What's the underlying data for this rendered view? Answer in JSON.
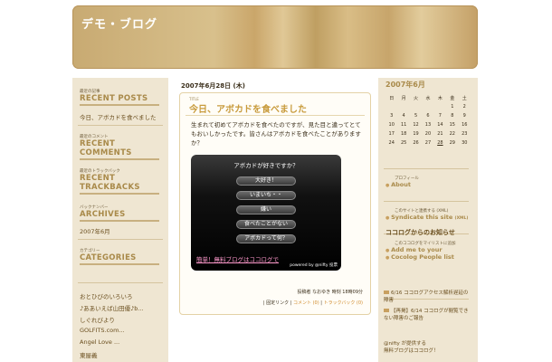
{
  "header": {
    "title": "デモ・ブログ"
  },
  "left": {
    "recent_posts_small": "最近の記事",
    "recent_posts": "RECENT POSTS",
    "recent_post_1": "今日、アボカドを食べました",
    "recent_comments_small": "最近のコメント",
    "recent_comments": "RECENT COMMENTS",
    "recent_trackbacks_small": "最近のトラックバック",
    "recent_trackbacks": "RECENT TRACKBACKS",
    "archives_small": "バックナンバー",
    "archives": "ARCHIVES",
    "archive_1": "2007年6月",
    "categories_small": "カテゴリー",
    "categories": "CATEGORIES",
    "links": [
      "おとひびのいろいろ",
      "♪ああいえば山田優♪b...",
      "しぐれびより",
      "GOLFITS.com...",
      "Angel Love ...",
      "東屋義"
    ]
  },
  "main": {
    "date": "2007年6月28日 (木)",
    "post_tag": "TITLE",
    "post_title": "今日、アボカドを食べました",
    "body": "生まれて初めてアボカドを食べたのですが、見た目と違ってとてもおいしかったです。皆さんはアボカドを食べたことがありますか？",
    "poll": {
      "question": "アボカドが好きですか？",
      "options": [
        "大好き！",
        "いまいち・・",
        "嫌い",
        "食べたことがない",
        "アボカドって何？"
      ],
      "link": "簡単！無料ブログはココログで",
      "powered": "powered by @nifty 投票"
    },
    "footer_author": "投稿者 なおゆき 時刻 18時09分",
    "footer_permalink": "固定リンク",
    "footer_comment": "コメント (0)",
    "footer_trackback": "トラックバック (0)"
  },
  "right": {
    "calendar_title": "2007年6月",
    "weekdays": [
      "日",
      "月",
      "火",
      "水",
      "木",
      "金",
      "土"
    ],
    "weeks": [
      [
        "",
        "",
        "",
        "",
        "",
        "1",
        "2"
      ],
      [
        "3",
        "4",
        "5",
        "6",
        "7",
        "8",
        "9"
      ],
      [
        "10",
        "11",
        "12",
        "13",
        "14",
        "15",
        "16"
      ],
      [
        "17",
        "18",
        "19",
        "20",
        "21",
        "22",
        "23"
      ],
      [
        "24",
        "25",
        "26",
        "27",
        "28",
        "29",
        "30"
      ]
    ],
    "profile_small": "プロフィール",
    "profile": "About",
    "syndicate_small": "このサイトと連携する (XML)",
    "syndicate": "Syndicate this site",
    "syndicate_xml": "(XML)",
    "people_small": "このココログをマイリストに追加",
    "people_1": "Add me to your",
    "people_2": "Cocolog People list",
    "kokolog_head": "ココログからのお知らせ",
    "news_1": "6/16 ココログアクセス解析遅延の障害",
    "news_2": "【再掲】6/14 ココログが閲覧できない障害のご報告",
    "nifty_1": "@nifty が提供する",
    "nifty_2": "無料ブログはココログ！"
  }
}
